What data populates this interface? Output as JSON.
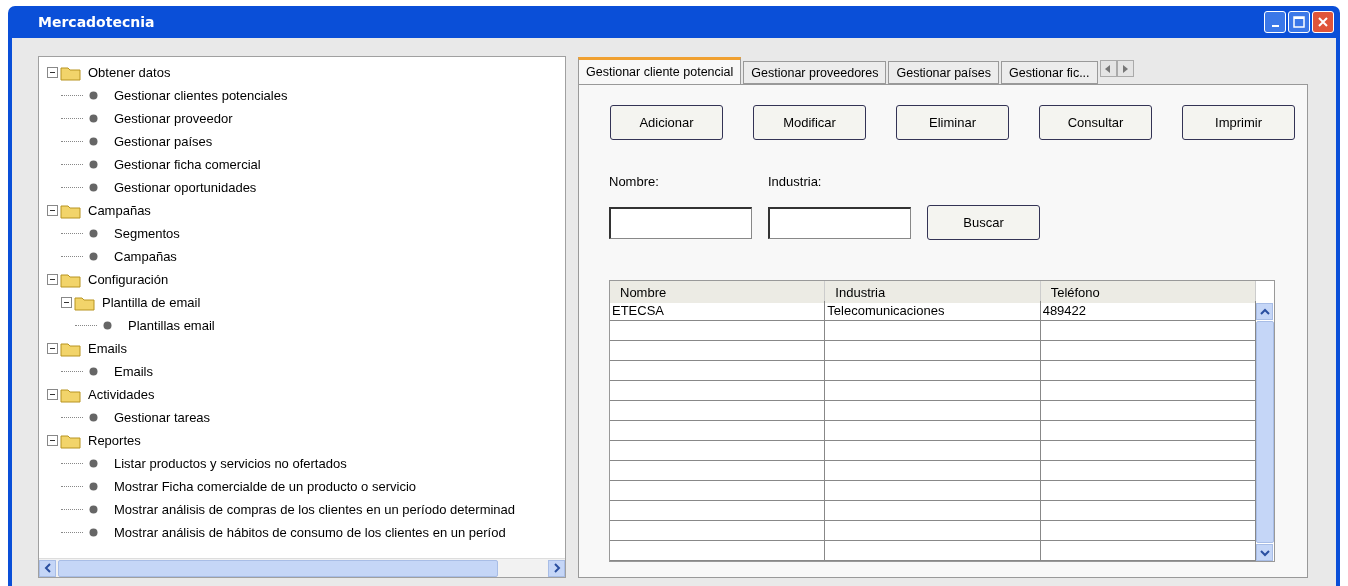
{
  "window": {
    "title": "Mercadotecnia"
  },
  "tree": [
    {
      "kind": "folder",
      "label": "Obtener datos",
      "expanded": true,
      "children": [
        {
          "kind": "leaf",
          "label": "Gestionar clientes potenciales"
        },
        {
          "kind": "leaf",
          "label": "Gestionar proveedor"
        },
        {
          "kind": "leaf",
          "label": "Gestionar países"
        },
        {
          "kind": "leaf",
          "label": "Gestionar ficha comercial"
        },
        {
          "kind": "leaf",
          "label": "Gestionar oportunidades"
        }
      ]
    },
    {
      "kind": "folder",
      "label": "Campañas",
      "expanded": true,
      "children": [
        {
          "kind": "leaf",
          "label": "Segmentos"
        },
        {
          "kind": "leaf",
          "label": "Campañas"
        }
      ]
    },
    {
      "kind": "folder",
      "label": "Configuración",
      "expanded": true,
      "children": [
        {
          "kind": "folder",
          "label": "Plantilla de email",
          "expanded": true,
          "children": [
            {
              "kind": "leaf",
              "label": "Plantillas email"
            }
          ]
        }
      ]
    },
    {
      "kind": "folder",
      "label": "Emails",
      "expanded": true,
      "children": [
        {
          "kind": "leaf",
          "label": "Emails"
        }
      ]
    },
    {
      "kind": "folder",
      "label": "Actividades",
      "expanded": true,
      "children": [
        {
          "kind": "leaf",
          "label": "Gestionar tareas"
        }
      ]
    },
    {
      "kind": "folder",
      "label": "Reportes",
      "expanded": true,
      "children": [
        {
          "kind": "leaf",
          "label": "Listar productos y servicios no ofertados"
        },
        {
          "kind": "leaf",
          "label": "Mostrar Ficha comercialde de un producto o servicio"
        },
        {
          "kind": "leaf",
          "label": "Mostrar análisis de compras de los clientes en un período determinad"
        },
        {
          "kind": "leaf",
          "label": "Mostrar análisis de hábitos de consumo de los clientes en un períod"
        }
      ]
    }
  ],
  "tabs": [
    {
      "label": "Gestionar cliente potencial",
      "selected": true
    },
    {
      "label": "Gestionar proveedores",
      "selected": false
    },
    {
      "label": "Gestionar países",
      "selected": false
    },
    {
      "label": "Gestionar fic...",
      "selected": false
    }
  ],
  "actions": [
    "Adicionar",
    "Modificar",
    "Eliminar",
    "Consultar",
    "Imprimir"
  ],
  "search": {
    "fields": [
      {
        "label": "Nombre:"
      },
      {
        "label": "Industria:"
      }
    ],
    "button": "Buscar"
  },
  "table": {
    "columns": [
      "Nombre",
      "Industria",
      "Teléfono"
    ],
    "rows": [
      [
        "ETECSA",
        "Telecomunicaciones",
        "489422"
      ]
    ]
  }
}
